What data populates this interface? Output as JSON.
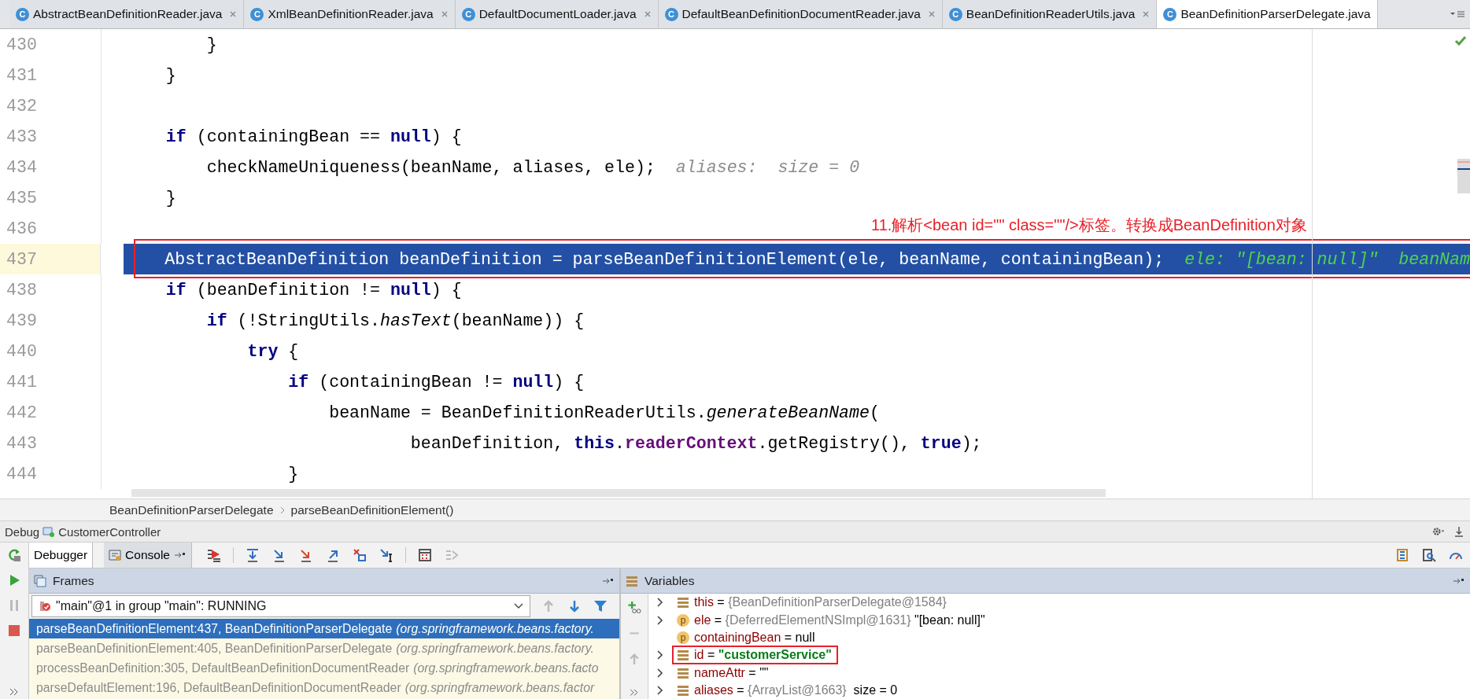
{
  "editor_tabs": [
    {
      "badge": "C",
      "label": "AbstractBeanDefinitionReader.java",
      "closable": true,
      "selected": false
    },
    {
      "badge": "C",
      "label": "XmlBeanDefinitionReader.java",
      "closable": true,
      "selected": false
    },
    {
      "badge": "C",
      "label": "DefaultDocumentLoader.java",
      "closable": true,
      "selected": false
    },
    {
      "badge": "C",
      "label": "DefaultBeanDefinitionDocumentReader.java",
      "closable": true,
      "selected": false
    },
    {
      "badge": "C",
      "label": "BeanDefinitionReaderUtils.java",
      "closable": true,
      "selected": false
    },
    {
      "badge": "C",
      "label": "BeanDefinitionParserDelegate.java",
      "closable": false,
      "selected": true
    }
  ],
  "code_lines": [
    {
      "number": "430",
      "selected": false,
      "boxed": false,
      "segments": [
        {
          "text": "        }",
          "kind": "plain"
        }
      ]
    },
    {
      "number": "431",
      "selected": false,
      "boxed": false,
      "segments": [
        {
          "text": "    }",
          "kind": "plain"
        }
      ]
    },
    {
      "number": "432",
      "selected": false,
      "boxed": false
    },
    {
      "number": "433",
      "selected": false,
      "boxed": false,
      "segments": [
        {
          "text": "    if",
          "kind": "keyword"
        },
        {
          "text": " (containingBean == ",
          "kind": "plain"
        },
        {
          "text": "null",
          "kind": "keyword"
        },
        {
          "text": ") {",
          "kind": "plain"
        }
      ]
    },
    {
      "number": "434",
      "selected": false,
      "boxed": false,
      "segments": [
        {
          "text": "        checkNameUniqueness(beanName, aliases, ele);",
          "kind": "plain"
        }
      ],
      "inline_value": "aliases:  size = 0"
    },
    {
      "number": "435",
      "selected": false,
      "boxed": false,
      "segments": [
        {
          "text": "    }",
          "kind": "plain"
        }
      ]
    },
    {
      "number": "436",
      "selected": false,
      "boxed": false,
      "note": "11.解析<bean id=\"\" class=\"\"/>标签。转换成BeanDefinition对象"
    },
    {
      "number": "437",
      "selected": true,
      "boxed": true,
      "segments": [
        {
          "text": "    AbstractBeanDefinition beanDefinition = parseBeanDefinitionElement(ele, beanName, containingBean);",
          "kind": "plain"
        }
      ],
      "inline_value": "ele: \"[bean: null]\"  beanNam"
    },
    {
      "number": "438",
      "selected": false,
      "boxed": false,
      "segments": [
        {
          "text": "    if",
          "kind": "keyword"
        },
        {
          "text": " (beanDefinition != ",
          "kind": "plain"
        },
        {
          "text": "null",
          "kind": "keyword"
        },
        {
          "text": ") {",
          "kind": "plain"
        }
      ]
    },
    {
      "number": "439",
      "selected": false,
      "boxed": false,
      "segments": [
        {
          "text": "        if",
          "kind": "keyword"
        },
        {
          "text": " (!StringUtils.",
          "kind": "plain"
        },
        {
          "text": "hasText",
          "kind": "static"
        },
        {
          "text": "(beanName)) {",
          "kind": "plain"
        }
      ]
    },
    {
      "number": "440",
      "selected": false,
      "boxed": false,
      "segments": [
        {
          "text": "            try",
          "kind": "keyword"
        },
        {
          "text": " {",
          "kind": "plain"
        }
      ]
    },
    {
      "number": "441",
      "selected": false,
      "boxed": false,
      "segments": [
        {
          "text": "                if",
          "kind": "keyword"
        },
        {
          "text": " (containingBean != ",
          "kind": "plain"
        },
        {
          "text": "null",
          "kind": "keyword"
        },
        {
          "text": ") {",
          "kind": "plain"
        }
      ]
    },
    {
      "number": "442",
      "selected": false,
      "boxed": false,
      "segments": [
        {
          "text": "                    beanName = BeanDefinitionReaderUtils.",
          "kind": "plain"
        },
        {
          "text": "generateBeanName",
          "kind": "static"
        },
        {
          "text": "(",
          "kind": "plain"
        }
      ]
    },
    {
      "number": "443",
      "selected": false,
      "boxed": false,
      "segments": [
        {
          "text": "                            beanDefinition, ",
          "kind": "plain"
        },
        {
          "text": "this",
          "kind": "keyword"
        },
        {
          "text": ".",
          "kind": "plain"
        },
        {
          "text": "readerContext",
          "kind": "field"
        },
        {
          "text": ".getRegistry(), ",
          "kind": "plain"
        },
        {
          "text": "true",
          "kind": "keyword"
        },
        {
          "text": ");",
          "kind": "plain"
        }
      ]
    },
    {
      "number": "444",
      "selected": false,
      "boxed": false,
      "segments": [
        {
          "text": "                }",
          "kind": "plain"
        }
      ]
    }
  ],
  "breadcrumbs": [
    "BeanDefinitionParserDelegate",
    "parseBeanDefinitionElement()"
  ],
  "debug_header": {
    "title": "Debug",
    "config": "CustomerController"
  },
  "debug_tabs": [
    {
      "label": "Debugger",
      "selected": true
    },
    {
      "label": "Console",
      "selected": false
    }
  ],
  "frames": {
    "title": "Frames",
    "thread": "\"main\"@1 in group \"main\": RUNNING",
    "rows": [
      {
        "method": "parseBeanDefinitionElement:437, BeanDefinitionParserDelegate",
        "package": "(org.springframework.beans.factory.",
        "selected": true
      },
      {
        "method": "parseBeanDefinitionElement:405, BeanDefinitionParserDelegate",
        "package": "(org.springframework.beans.factory.",
        "selected": false
      },
      {
        "method": "processBeanDefinition:305, DefaultBeanDefinitionDocumentReader",
        "package": "(org.springframework.beans.facto",
        "selected": false
      },
      {
        "method": "parseDefaultElement:196, DefaultBeanDefinitionDocumentReader",
        "package": "(org.springframework.beans.factor",
        "selected": false
      }
    ]
  },
  "variables": {
    "title": "Variables",
    "rows": [
      {
        "kind": "field",
        "expandable": true,
        "boxed": false,
        "name": "this",
        "value": [
          {
            "text": " = ",
            "kind": "plain"
          },
          {
            "text": "{BeanDefinitionParserDelegate@1584}",
            "kind": "ref"
          }
        ]
      },
      {
        "kind": "param",
        "badge": "p",
        "expandable": true,
        "boxed": false,
        "name": "ele",
        "value": [
          {
            "text": " = ",
            "kind": "plain"
          },
          {
            "text": "{DeferredElementNSImpl@1631}",
            "kind": "ref"
          },
          {
            "text": " \"[bean: null]\"",
            "kind": "plain"
          }
        ]
      },
      {
        "kind": "param",
        "badge": "p",
        "expandable": false,
        "boxed": false,
        "name": "containingBean",
        "value": [
          {
            "text": " = null",
            "kind": "plain"
          }
        ]
      },
      {
        "kind": "field",
        "expandable": true,
        "boxed": true,
        "name": "id",
        "value": [
          {
            "text": " = ",
            "kind": "plain"
          },
          {
            "text": "\"customerService\"",
            "kind": "string"
          }
        ]
      },
      {
        "kind": "field",
        "expandable": true,
        "boxed": false,
        "name": "nameAttr",
        "value": [
          {
            "text": " = \"\"",
            "kind": "plain"
          }
        ]
      },
      {
        "kind": "field",
        "expandable": true,
        "boxed": false,
        "name": "aliases",
        "value": [
          {
            "text": " = ",
            "kind": "plain"
          },
          {
            "text": "{ArrayList@1663}",
            "kind": "ref"
          },
          {
            "text": "  size = 0",
            "kind": "plain"
          }
        ]
      }
    ]
  }
}
